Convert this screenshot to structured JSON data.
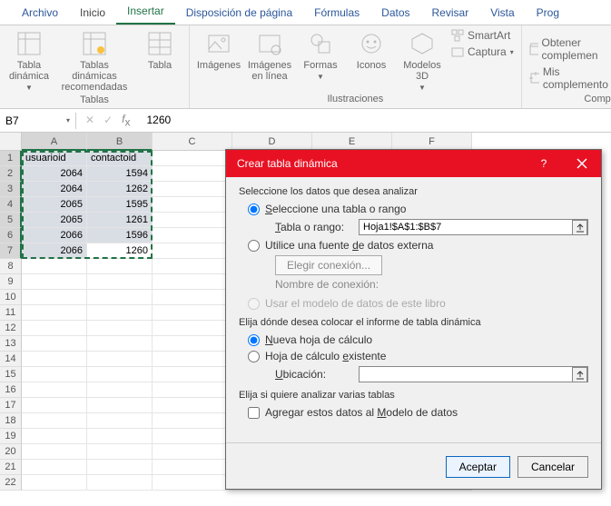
{
  "tabs": {
    "file": "Archivo",
    "home": "Inicio",
    "insert": "Insertar",
    "layout": "Disposición de página",
    "formulas": "Fórmulas",
    "data": "Datos",
    "review": "Revisar",
    "view": "Vista",
    "prog": "Prog"
  },
  "ribbon": {
    "tables": {
      "pivot": "Tabla\ndinámica",
      "recpivot": "Tablas dinámicas\nrecomendadas",
      "table": "Tabla",
      "group": "Tablas"
    },
    "illus": {
      "images": "Imágenes",
      "online": "Imágenes\nen línea",
      "shapes": "Formas",
      "icons": "Iconos",
      "models": "Modelos\n3D",
      "group": "Ilustraciones"
    },
    "smartart": "SmartArt",
    "capture": "Captura",
    "addins": {
      "get": "Obtener complemen",
      "my": "Mis complemento",
      "group": "Comp"
    }
  },
  "namebox": "B7",
  "formula_value": "1260",
  "columns": [
    "A",
    "B",
    "C",
    "D",
    "E",
    "F"
  ],
  "rows_count": 22,
  "headers": {
    "A": "usuarioid",
    "B": "contactoid"
  },
  "data": [
    {
      "r": 2,
      "A": "2064",
      "B": "1594"
    },
    {
      "r": 3,
      "A": "2064",
      "B": "1262"
    },
    {
      "r": 4,
      "A": "2065",
      "B": "1595"
    },
    {
      "r": 5,
      "A": "2065",
      "B": "1261"
    },
    {
      "r": 6,
      "A": "2066",
      "B": "1596"
    },
    {
      "r": 7,
      "A": "2066",
      "B": "1260"
    }
  ],
  "dialog": {
    "title": "Crear tabla dinámica",
    "s1": "Seleccione los datos que desea analizar",
    "opt_range": "Seleccione una tabla o rango",
    "range_label": "Tabla o rango:",
    "range_value": "Hoja1!$A$1:$B$7",
    "opt_ext": "Utilice una fuente de datos externa",
    "btn_conn": "Elegir conexión...",
    "conn_label": "Nombre de conexión:",
    "opt_model": "Usar el modelo de datos de este libro",
    "s2": "Elija dónde desea colocar el informe de tabla dinámica",
    "opt_new": "Nueva hoja de cálculo",
    "opt_exist": "Hoja de cálculo existente",
    "loc_label": "Ubicación:",
    "loc_value": "",
    "s3": "Elija si quiere analizar varias tablas",
    "chk_add": "Agregar estos datos al Modelo de datos",
    "ok": "Aceptar",
    "cancel": "Cancelar"
  }
}
